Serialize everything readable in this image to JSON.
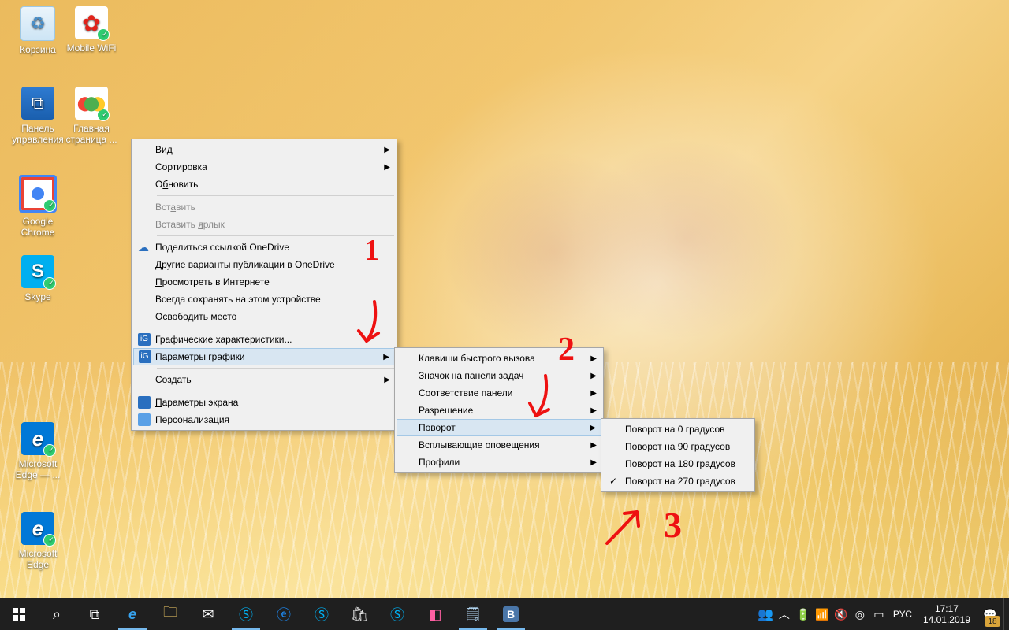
{
  "desktop_icons": [
    {
      "label": "Корзина"
    },
    {
      "label": "Mobile WiFi"
    },
    {
      "label": "Панель управления"
    },
    {
      "label": "Главная страница ..."
    },
    {
      "label": "Google Chrome"
    },
    {
      "label": "Skype"
    },
    {
      "label": "Microsoft Edge — ..."
    },
    {
      "label": "Microsoft Edge"
    }
  ],
  "menu1": {
    "view": "Вид",
    "sort": "Сортировка",
    "refresh_pre": "О",
    "refresh_u": "б",
    "refresh_post": "новить",
    "paste_pre": "Вст",
    "paste_u": "а",
    "paste_post": "вить",
    "paste_sc_pre": "Вставить ",
    "paste_sc_u": "я",
    "paste_sc_post": "рлык",
    "onedrive_share": "Поделиться ссылкой OneDrive",
    "onedrive_pub": "Другие варианты публикации в OneDrive",
    "browse_pre": "",
    "browse_u": "П",
    "browse_post": "росмотреть в Интернете",
    "always_keep": "Всегда сохранять на этом устройстве",
    "free_space": "Освободить место",
    "gfx_props": "Графические характеристики...",
    "gfx_params": "Параметры графики",
    "create_pre": "Созд",
    "create_u": "а",
    "create_post": "ть",
    "disp_pre": "",
    "disp_u": "П",
    "disp_post": "араметры экрана",
    "pers_pre": "П",
    "pers_u": "е",
    "pers_post": "рсонализация"
  },
  "menu2": {
    "hotkeys": "Клавиши быстрого вызова",
    "tray_icon": "Значок на панели задач",
    "panel_fit": "Соответствие панели",
    "resolution": "Разрешение",
    "rotation": "Поворот",
    "popups": "Всплывающие оповещения",
    "profiles": "Профили"
  },
  "menu3": {
    "r0": "Поворот на 0 градусов",
    "r90": "Поворот на 90 градусов",
    "r180": "Поворот на 180 градусов",
    "r270": "Поворот на 270 градусов"
  },
  "annotations": {
    "n1": "1",
    "n2": "2",
    "n3": "3"
  },
  "taskbar": {
    "lang": "РУС",
    "time": "17:17",
    "date": "14.01.2019",
    "notif_count": "18"
  }
}
